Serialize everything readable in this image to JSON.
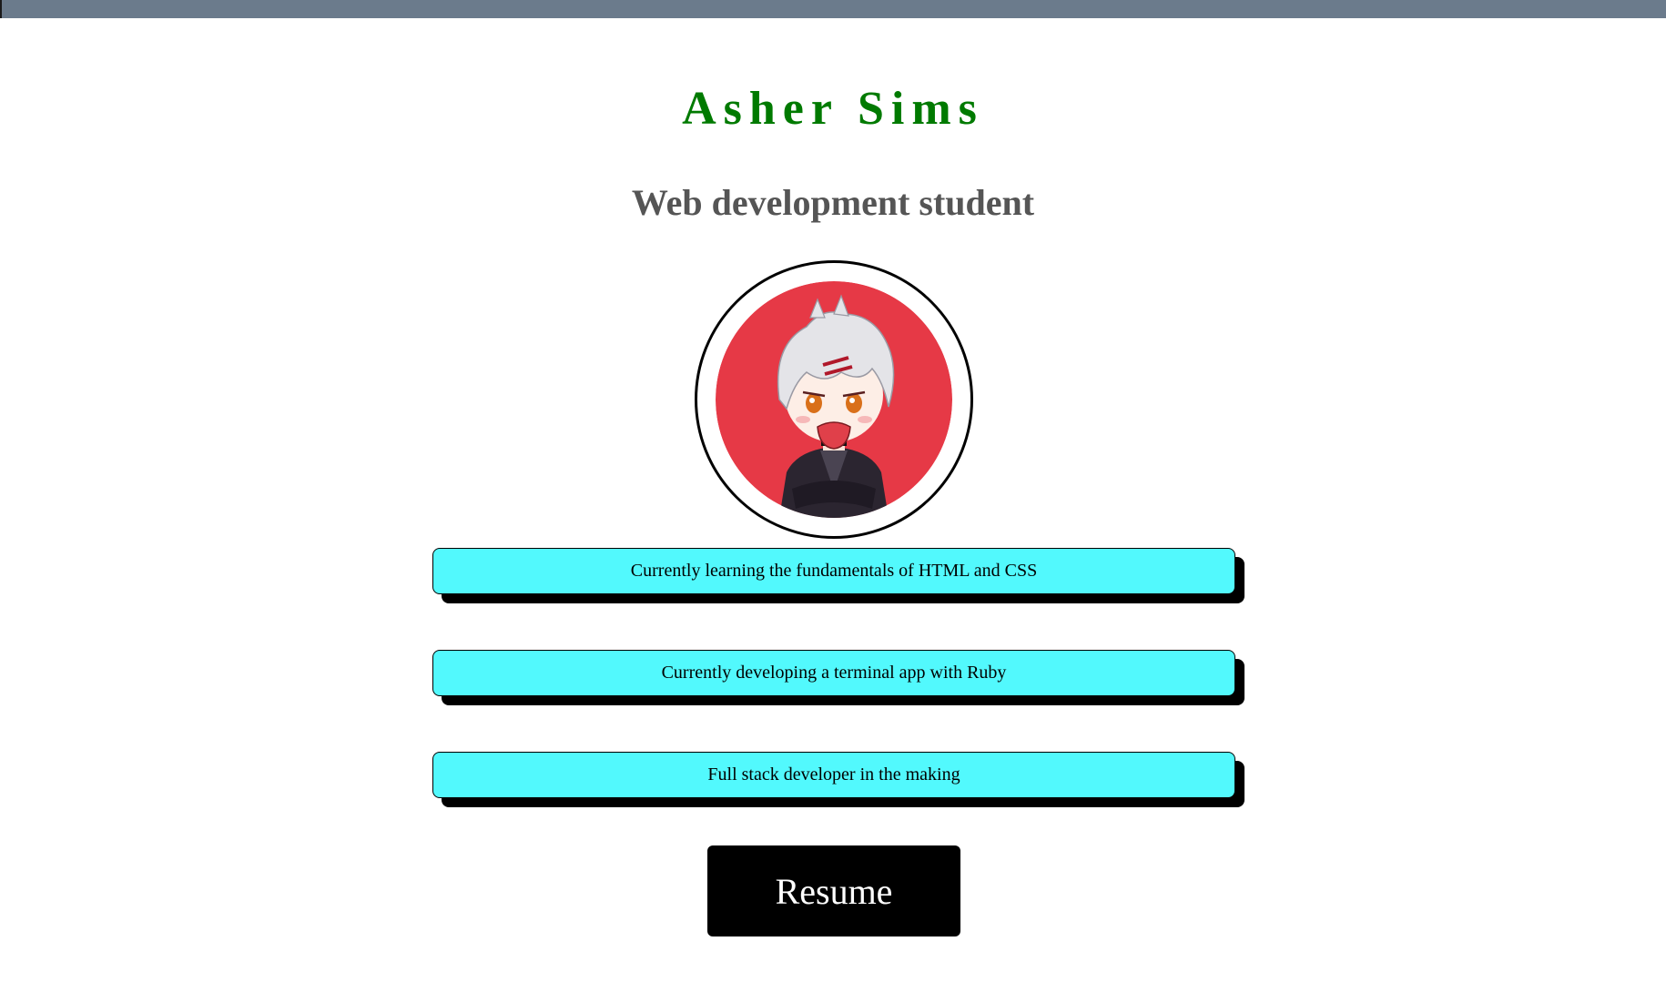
{
  "header": {
    "name": "Asher Sims",
    "subtitle": "Web development student"
  },
  "avatar": {
    "icon": "anime-character-avatar-icon",
    "background_color": "#e63946"
  },
  "info_items": [
    {
      "text": "Currently learning the fundamentals of HTML and CSS"
    },
    {
      "text": "Currently developing a terminal app with Ruby"
    },
    {
      "text": "Full stack developer in the making"
    }
  ],
  "resume_button": {
    "label": "Resume"
  },
  "colors": {
    "name": "#007a00",
    "subtitle": "#555555",
    "info_box": "#52f9fd",
    "button": "#000000",
    "topbar": "#6b7b8c"
  }
}
